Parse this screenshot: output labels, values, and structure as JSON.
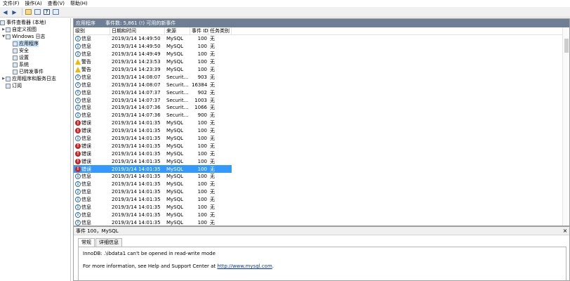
{
  "menu": [
    "文件(F)",
    "操作(A)",
    "查看(V)",
    "帮助(H)"
  ],
  "tree": {
    "root": "事件查看器 (本地)",
    "custom_views": "自定义视图",
    "windows_logs": "Windows 日志",
    "application": "应用程序",
    "security": "安全",
    "setup": "设置",
    "system": "系统",
    "forwarded": "已转发事件",
    "app_service_logs": "应用程序和服务日志",
    "subscriptions": "订阅"
  },
  "events_panel": {
    "title": "应用程序",
    "count_label": "事件数: 5,861 (!) 可用的新事件"
  },
  "columns": [
    "级别",
    "日期和时间",
    "来源",
    "事件 ID",
    "任务类别"
  ],
  "events": [
    {
      "level": "信息",
      "type": "info",
      "datetime": "2019/3/14 14:49:50",
      "source": "MySQL",
      "id": "100",
      "category": "无"
    },
    {
      "level": "信息",
      "type": "info",
      "datetime": "2019/3/14 14:49:50",
      "source": "MySQL",
      "id": "100",
      "category": "无"
    },
    {
      "level": "信息",
      "type": "info",
      "datetime": "2019/3/14 14:49:49",
      "source": "MySQL",
      "id": "100",
      "category": "无"
    },
    {
      "level": "警告",
      "type": "warn",
      "datetime": "2019/3/14 14:23:53",
      "source": "MySQL",
      "id": "100",
      "category": "无"
    },
    {
      "level": "警告",
      "type": "warn",
      "datetime": "2019/3/14 14:23:39",
      "source": "MySQL",
      "id": "100",
      "category": "无"
    },
    {
      "level": "信息",
      "type": "info",
      "datetime": "2019/3/14 14:08:07",
      "source": "Securit...",
      "id": "903",
      "category": "无"
    },
    {
      "level": "信息",
      "type": "info",
      "datetime": "2019/3/14 14:08:07",
      "source": "Securit...",
      "id": "16384",
      "category": "无"
    },
    {
      "level": "信息",
      "type": "info",
      "datetime": "2019/3/14 14:07:37",
      "source": "Securit...",
      "id": "902",
      "category": "无"
    },
    {
      "level": "信息",
      "type": "info",
      "datetime": "2019/3/14 14:07:37",
      "source": "Securit...",
      "id": "1003",
      "category": "无"
    },
    {
      "level": "信息",
      "type": "info",
      "datetime": "2019/3/14 14:07:36",
      "source": "Securit...",
      "id": "1066",
      "category": "无"
    },
    {
      "level": "信息",
      "type": "info",
      "datetime": "2019/3/14 14:07:36",
      "source": "Securit...",
      "id": "900",
      "category": "无"
    },
    {
      "level": "错误",
      "type": "err",
      "datetime": "2019/3/14 14:01:35",
      "source": "MySQL",
      "id": "100",
      "category": "无"
    },
    {
      "level": "错误",
      "type": "err",
      "datetime": "2019/3/14 14:01:35",
      "source": "MySQL",
      "id": "100",
      "category": "无"
    },
    {
      "level": "信息",
      "type": "info",
      "datetime": "2019/3/14 14:01:35",
      "source": "MySQL",
      "id": "100",
      "category": "无"
    },
    {
      "level": "错误",
      "type": "err",
      "datetime": "2019/3/14 14:01:35",
      "source": "MySQL",
      "id": "100",
      "category": "无"
    },
    {
      "level": "错误",
      "type": "err",
      "datetime": "2019/3/14 14:01:35",
      "source": "MySQL",
      "id": "100",
      "category": "无"
    },
    {
      "level": "错误",
      "type": "err",
      "datetime": "2019/3/14 14:01:35",
      "source": "MySQL",
      "id": "100",
      "category": "无"
    },
    {
      "level": "错误",
      "type": "err",
      "datetime": "2019/3/14 14:01:35",
      "source": "MySQL",
      "id": "100",
      "category": "无",
      "selected": true
    },
    {
      "level": "信息",
      "type": "info",
      "datetime": "2019/3/14 14:01:35",
      "source": "MySQL",
      "id": "100",
      "category": "无"
    },
    {
      "level": "信息",
      "type": "info",
      "datetime": "2019/3/14 14:01:35",
      "source": "MySQL",
      "id": "100",
      "category": "无"
    },
    {
      "level": "信息",
      "type": "info",
      "datetime": "2019/3/14 14:01:35",
      "source": "MySQL",
      "id": "100",
      "category": "无"
    },
    {
      "level": "信息",
      "type": "info",
      "datetime": "2019/3/14 14:01:35",
      "source": "MySQL",
      "id": "100",
      "category": "无"
    },
    {
      "level": "信息",
      "type": "info",
      "datetime": "2019/3/14 14:01:35",
      "source": "MySQL",
      "id": "100",
      "category": "无"
    },
    {
      "level": "信息",
      "type": "info",
      "datetime": "2019/3/14 14:01:35",
      "source": "MySQL",
      "id": "100",
      "category": "无"
    },
    {
      "level": "信息",
      "type": "info",
      "datetime": "2019/3/14 14:01:35",
      "source": "MySQL",
      "id": "100",
      "category": "无"
    },
    {
      "level": "信息",
      "type": "info",
      "datetime": "2019/3/14 14:01:35",
      "source": "MySQL",
      "id": "100",
      "category": "无"
    }
  ],
  "detail": {
    "title": "事件 100，MySQL",
    "close": "×",
    "tab_general": "常规",
    "tab_details": "详细信息",
    "message": "InnoDB: .\\ibdata1 can't be opened in read-write mode",
    "help_prefix": "For more information, see Help and Support Center at ",
    "help_link": "http://www.mysql.com",
    "help_suffix": "."
  }
}
